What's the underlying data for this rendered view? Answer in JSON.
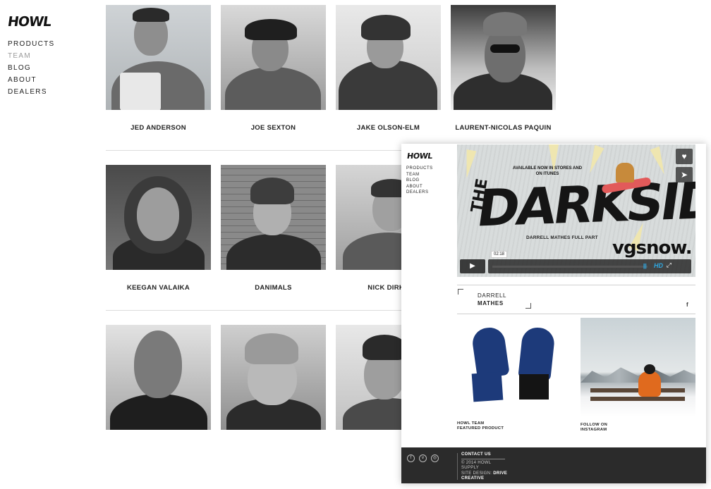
{
  "brand": {
    "logo": "HOWL"
  },
  "nav": {
    "items": [
      "PRODUCTS",
      "TEAM",
      "BLOG",
      "ABOUT",
      "DEALERS"
    ],
    "active": "TEAM"
  },
  "team": {
    "row1": [
      "JED ANDERSON",
      "JOE SEXTON",
      "JAKE OLSON-ELM",
      "LAURENT-NICOLAS PAQUIN"
    ],
    "row2": [
      "KEEGAN VALAIKA",
      "DANIMALS",
      "NICK DIRKS"
    ],
    "row3": [
      "",
      "",
      ""
    ]
  },
  "overlay": {
    "logo": "HOWL",
    "nav": [
      "PRODUCTS",
      "TEAM",
      "BLOG",
      "ABOUT",
      "DEALERS"
    ],
    "video": {
      "title": "DARKSIDE",
      "the": "THE",
      "availability": "AVAILABLE NOW IN STORES AND ON ITUNES",
      "part": "DARRELL MATHES FULL PART",
      "producer": "vgsnow.",
      "time": "02:18",
      "hd_label": "HD",
      "like_icon": "heart-icon",
      "share_icon": "send-icon"
    },
    "rider": {
      "first": "DARRELL",
      "last": "MATHES",
      "social": "f"
    },
    "tiles": [
      {
        "line1": "HOWL TEAM",
        "line2": "FEATURED PRODUCT"
      },
      {
        "line1": "FOLLOW ON",
        "line2": "INSTAGRAM"
      }
    ],
    "footer": {
      "social": [
        "f",
        "v",
        "◎"
      ],
      "contact": "CONTACT US",
      "copyright": "© 2014 HOWL",
      "company": "SUPPLY",
      "design_label": "SITE DESIGN:",
      "design_by": "DRIVE",
      "design_by_2": "CREATIVE"
    }
  },
  "colors": {
    "accent_active_nav": "#9a9a9a",
    "footer_bg": "#2b2b2b",
    "video_blue": "#2fa7e0"
  }
}
